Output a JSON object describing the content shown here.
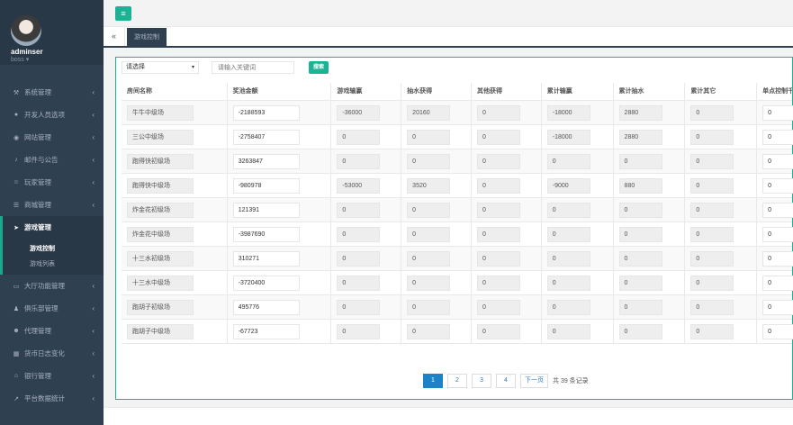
{
  "user": {
    "name": "adminser",
    "role": "boss ▾"
  },
  "menu": [
    {
      "icon": "⚒",
      "label": "系统管理"
    },
    {
      "icon": "●",
      "label": "开发人员选项"
    },
    {
      "icon": "◉",
      "label": "网站管理"
    },
    {
      "icon": "♪",
      "label": "邮件与公告"
    },
    {
      "icon": "☺",
      "label": "玩家管理"
    },
    {
      "icon": "☰",
      "label": "商城管理"
    },
    {
      "icon": "➤",
      "label": "游戏管理"
    },
    {
      "icon": "▭",
      "label": "大厅功能管理"
    },
    {
      "icon": "♟",
      "label": "俱乐部管理"
    },
    {
      "icon": "☻",
      "label": "代理管理"
    },
    {
      "icon": "▦",
      "label": "货币日志变化"
    },
    {
      "icon": "⌂",
      "label": "银行管理"
    },
    {
      "icon": "↗",
      "label": "平台数据统计"
    }
  ],
  "submenu": [
    "游戏控制",
    "游戏列表"
  ],
  "chevron": "‹",
  "tab": {
    "nav": "«",
    "label": "游戏控制"
  },
  "toolbar_icon": "≡",
  "filter": {
    "select": "请选择",
    "select_arrow": "▾",
    "placeholder": "请输入关键词",
    "search": "搜索"
  },
  "columns": [
    "房间名称",
    "奖池金额",
    "游戏输赢",
    "抽水获得",
    "其他获得",
    "累计输赢",
    "累计抽水",
    "累计其它",
    "单点控制千"
  ],
  "rows": [
    [
      "牛牛中级场",
      "-2188593",
      "-36000",
      "20160",
      "0",
      "-18000",
      "2880",
      "0",
      "0"
    ],
    [
      "三公中级场",
      "-2758407",
      "0",
      "0",
      "0",
      "-18000",
      "2880",
      "0",
      "0"
    ],
    [
      "跑得快初级场",
      "3263847",
      "0",
      "0",
      "0",
      "0",
      "0",
      "0",
      "0"
    ],
    [
      "跑得快中级场",
      "-980978",
      "-53000",
      "3520",
      "0",
      "-9000",
      "880",
      "0",
      "0"
    ],
    [
      "炸金花初级场",
      "121391",
      "0",
      "0",
      "0",
      "0",
      "0",
      "0",
      "0"
    ],
    [
      "炸金花中级场",
      "-3987690",
      "0",
      "0",
      "0",
      "0",
      "0",
      "0",
      "0"
    ],
    [
      "十三水初级场",
      "310271",
      "0",
      "0",
      "0",
      "0",
      "0",
      "0",
      "0"
    ],
    [
      "十三水中级场",
      "-3720400",
      "0",
      "0",
      "0",
      "0",
      "0",
      "0",
      "0"
    ],
    [
      "跑胡子初级场",
      "495776",
      "0",
      "0",
      "0",
      "0",
      "0",
      "0",
      "0"
    ],
    [
      "跑胡子中级场",
      "-67723",
      "0",
      "0",
      "0",
      "0",
      "0",
      "0",
      "0"
    ]
  ],
  "pagination": {
    "pages": [
      "1",
      "2",
      "3",
      "4"
    ],
    "next": "下一页",
    "total": "共 39 条记录"
  }
}
